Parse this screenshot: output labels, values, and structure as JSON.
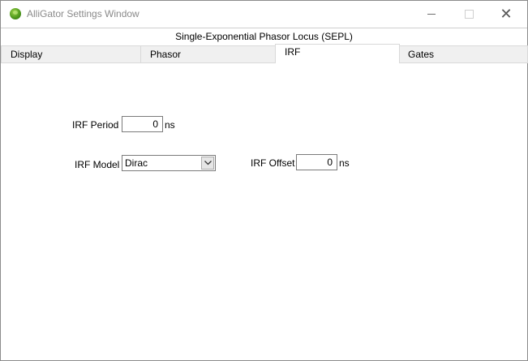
{
  "window": {
    "title": "AlliGator Settings Window",
    "icons": {
      "app": "alligator-app-icon",
      "minimize": "minimize-icon",
      "maximize": "maximize-icon",
      "close": "close-icon"
    }
  },
  "header": {
    "title": "Single-Exponential Phasor Locus (SEPL)"
  },
  "tabs": [
    {
      "label": "Display",
      "active": false
    },
    {
      "label": "Phasor",
      "active": false
    },
    {
      "label": "IRF",
      "active": true
    },
    {
      "label": "Gates",
      "active": false
    }
  ],
  "irf": {
    "period_label": "IRF Period",
    "period_value": "0",
    "period_unit": "ns",
    "model_label": "IRF Model",
    "model_value": "Dirac",
    "offset_label": "IRF Offset",
    "offset_value": "0",
    "offset_unit": "ns"
  }
}
